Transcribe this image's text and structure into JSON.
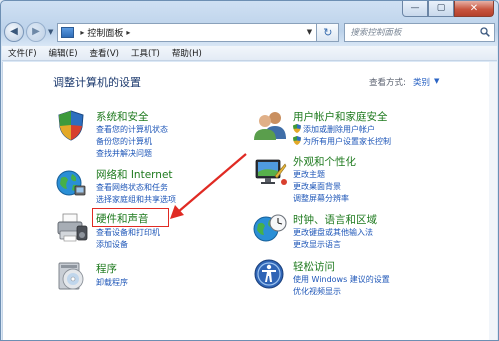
{
  "window": {
    "address": {
      "path": "控制面板",
      "separator": "▸"
    },
    "search_placeholder": "搜索控制面板",
    "caption": {
      "minimize": "—",
      "maximize": "▢",
      "close": "✕"
    }
  },
  "menu": [
    "文件(F)",
    "编辑(E)",
    "查看(V)",
    "工具(T)",
    "帮助(H)"
  ],
  "page": {
    "title": "调整计算机的设置",
    "view_by_label": "查看方式:",
    "view_by_value": "类别",
    "view_by_caret": "▼"
  },
  "categories": {
    "system": {
      "title": "系统和安全",
      "links": [
        "查看您的计算机状态",
        "备份您的计算机",
        "查找并解决问题"
      ],
      "icon": "shield-flag-icon"
    },
    "network": {
      "title": "网络和 Internet",
      "links": [
        "查看网络状态和任务",
        "选择家庭组和共享选项"
      ],
      "icon": "globe-network-icon"
    },
    "hardware": {
      "title": "硬件和声音",
      "links": [
        "查看设备和打印机",
        "添加设备"
      ],
      "icon": "printer-icon"
    },
    "programs": {
      "title": "程序",
      "links": [
        "卸载程序"
      ],
      "icon": "program-disc-icon"
    },
    "users": {
      "title": "用户帐户和家庭安全",
      "links": [
        "添加或删除用户帐户",
        "为所有用户设置家长控制"
      ],
      "icon": "users-icon"
    },
    "appearance": {
      "title": "外观和个性化",
      "links": [
        "更改主题",
        "更改桌面背景",
        "调整屏幕分辨率"
      ],
      "icon": "monitor-paint-icon"
    },
    "clock": {
      "title": "时钟、语言和区域",
      "links": [
        "更改键盘或其他输入法",
        "更改显示语言"
      ],
      "icon": "clock-globe-icon"
    },
    "ease": {
      "title": "轻松访问",
      "links": [
        "使用 Windows 建议的设置",
        "优化视频显示"
      ],
      "icon": "ease-access-icon"
    }
  },
  "colors": {
    "title_green": "#1e7a1e",
    "link_blue": "#1f57b8",
    "annotation_red": "#e02a23"
  }
}
